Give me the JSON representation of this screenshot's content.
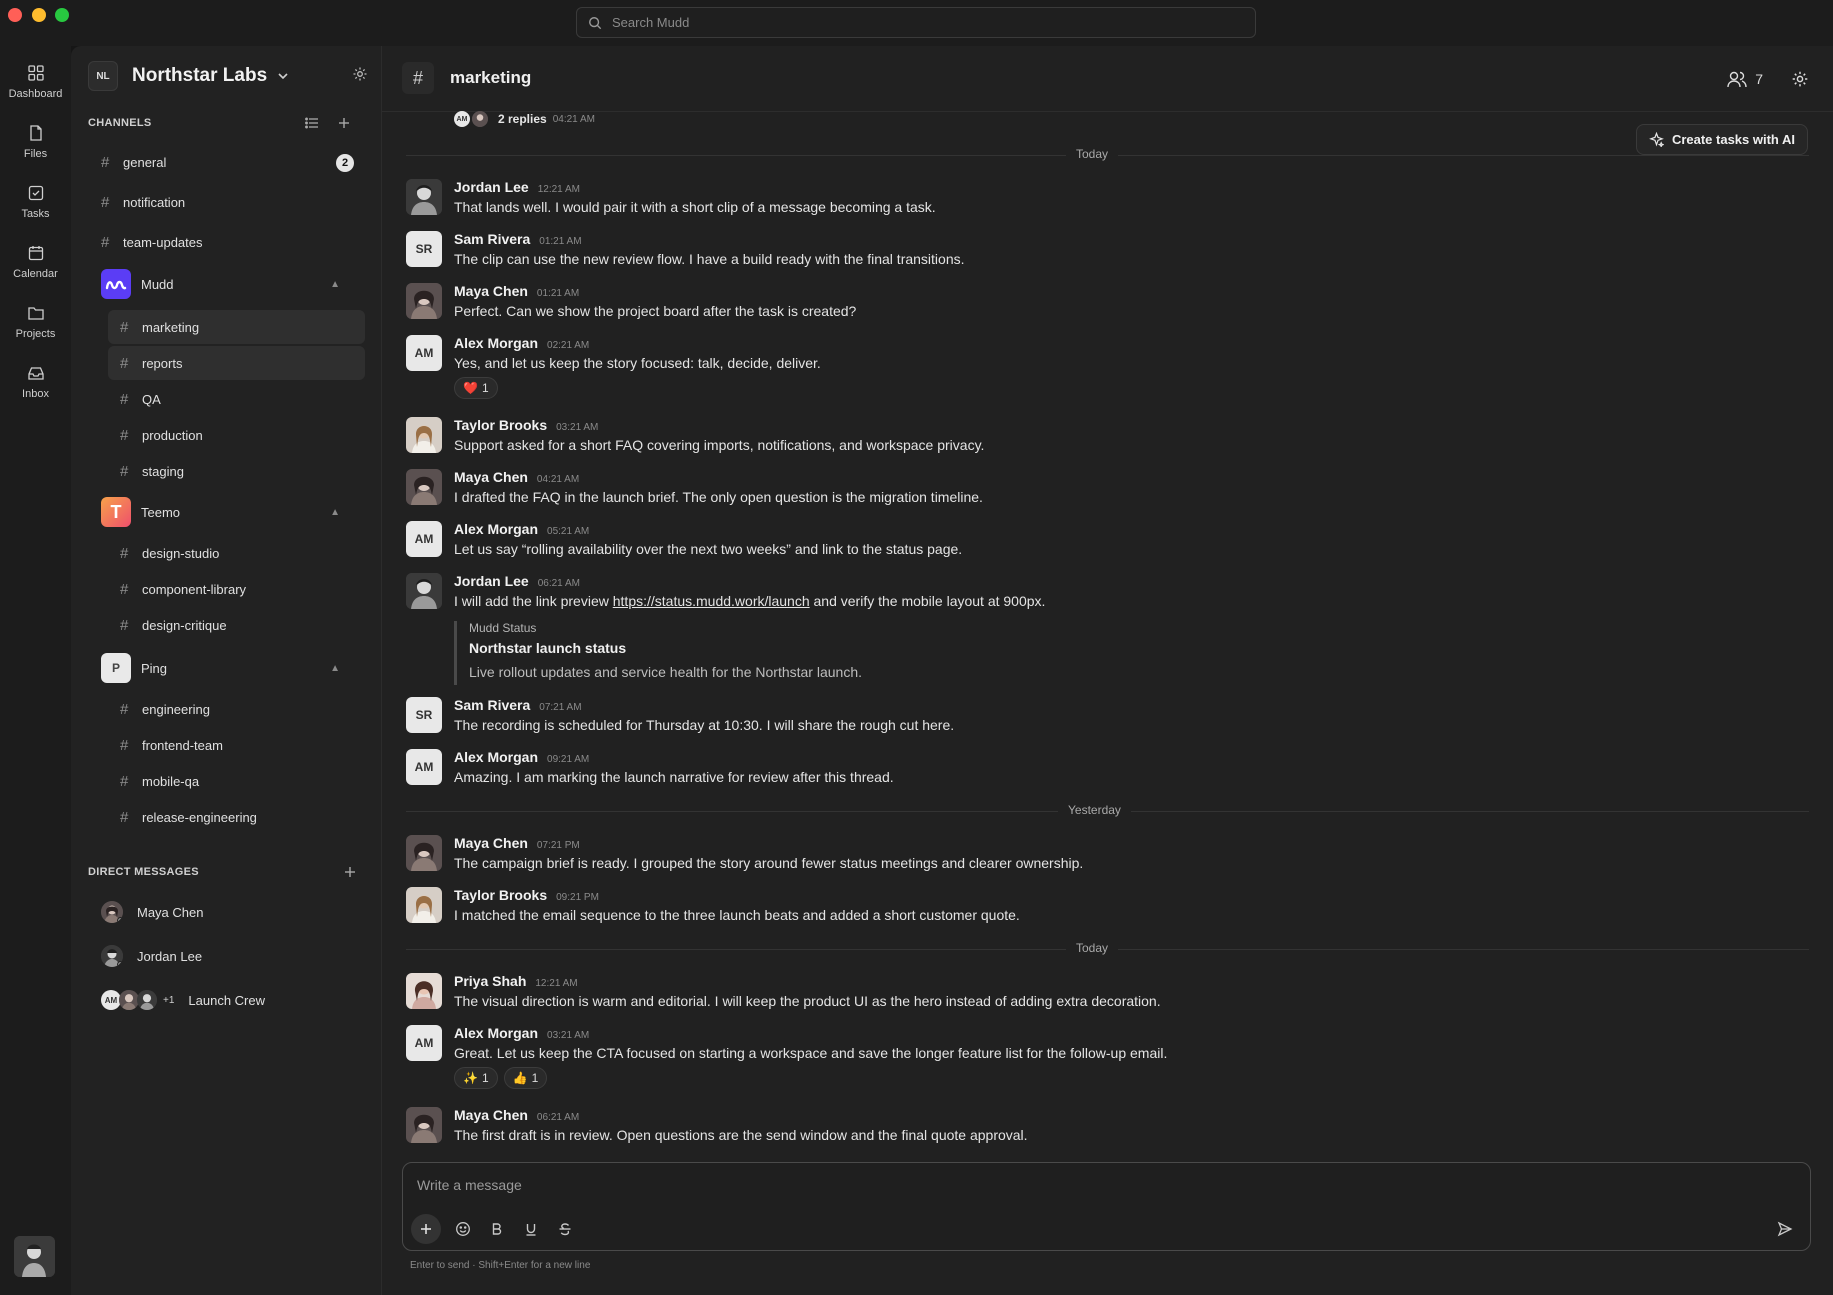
{
  "search": {
    "placeholder": "Search Mudd"
  },
  "rail": [
    {
      "label": "Dashboard",
      "icon": "dashboard-icon"
    },
    {
      "label": "Files",
      "icon": "file-icon"
    },
    {
      "label": "Tasks",
      "icon": "task-icon"
    },
    {
      "label": "Calendar",
      "icon": "calendar-icon"
    },
    {
      "label": "Projects",
      "icon": "folder-icon"
    },
    {
      "label": "Inbox",
      "icon": "inbox-icon"
    }
  ],
  "workspace": {
    "initials": "NL",
    "name": "Northstar Labs"
  },
  "channels_label": "CHANNELS",
  "channels": [
    {
      "name": "general",
      "badge": "2"
    },
    {
      "name": "notification"
    },
    {
      "name": "team-updates"
    }
  ],
  "groups": [
    {
      "name": "Mudd",
      "logo": "",
      "channels": [
        "marketing",
        "reports",
        "QA",
        "production",
        "staging"
      ]
    },
    {
      "name": "Teemo",
      "logo": "T",
      "channels": [
        "design-studio",
        "component-library",
        "design-critique"
      ]
    },
    {
      "name": "Ping",
      "logo": "P",
      "channels": [
        "engineering",
        "frontend-team",
        "mobile-qa",
        "release-engineering"
      ]
    }
  ],
  "dm_label": "DIRECT MESSAGES",
  "dms": [
    {
      "name": "Maya Chen"
    },
    {
      "name": "Jordan Lee"
    },
    {
      "name": "Launch Crew",
      "initials": "AM",
      "extra": "+1"
    }
  ],
  "header": {
    "channel": "marketing",
    "members": "7"
  },
  "ai_button": "Create tasks with AI",
  "thread_summary": {
    "initials": "AM",
    "replies": "2 replies",
    "time": "04:21 AM"
  },
  "dividers": [
    "Today",
    "Yesterday",
    "Today"
  ],
  "messages": [
    {
      "name": "Jordan Lee",
      "time": "12:21 AM",
      "text": "That lands well. I would pair it with a short clip of a message becoming a task."
    },
    {
      "name": "Sam Rivera",
      "initials": "SR",
      "time": "01:21 AM",
      "text": "The clip can use the new review flow. I have a build ready with the final transitions."
    },
    {
      "name": "Maya Chen",
      "time": "01:21 AM",
      "text": "Perfect. Can we show the project board after the task is created?"
    },
    {
      "name": "Alex Morgan",
      "initials": "AM",
      "time": "02:21 AM",
      "text": "Yes, and let us keep the story focused: talk, decide, deliver.",
      "reactions": [
        {
          "emoji": "❤️",
          "count": "1"
        }
      ]
    },
    {
      "name": "Taylor Brooks",
      "time": "03:21 AM",
      "text": "Support asked for a short FAQ covering imports, notifications, and workspace privacy."
    },
    {
      "name": "Maya Chen",
      "time": "04:21 AM",
      "text": "I drafted the FAQ in the launch brief. The only open question is the migration timeline."
    },
    {
      "name": "Alex Morgan",
      "initials": "AM",
      "time": "05:21 AM",
      "text": "Let us say “rolling availability over the next two weeks” and link to the status page."
    },
    {
      "name": "Jordan Lee",
      "time": "06:21 AM",
      "text_before": "I will add the link preview ",
      "link": "https://status.mudd.work/launch",
      "text_after": " and verify the mobile layout at 900px.",
      "preview": {
        "source": "Mudd Status",
        "title": "Northstar launch status",
        "desc": "Live rollout updates and service health for the Northstar launch."
      }
    },
    {
      "name": "Sam Rivera",
      "initials": "SR",
      "time": "07:21 AM",
      "text": "The recording is scheduled for Thursday at 10:30. I will share the rough cut here."
    },
    {
      "name": "Alex Morgan",
      "initials": "AM",
      "time": "09:21 AM",
      "text": "Amazing. I am marking the launch narrative for review after this thread."
    },
    {
      "name": "Maya Chen",
      "time": "07:21 PM",
      "text": "The campaign brief is ready. I grouped the story around fewer status meetings and clearer ownership."
    },
    {
      "name": "Taylor Brooks",
      "time": "09:21 PM",
      "text": "I matched the email sequence to the three launch beats and added a short customer quote."
    },
    {
      "name": "Priya Shah",
      "time": "12:21 AM",
      "text": "The visual direction is warm and editorial. I will keep the product UI as the hero instead of adding extra decoration."
    },
    {
      "name": "Alex Morgan",
      "initials": "AM",
      "time": "03:21 AM",
      "text": "Great. Let us keep the CTA focused on starting a workspace and save the longer feature list for the follow-up email.",
      "reactions": [
        {
          "emoji": "✨",
          "count": "1"
        },
        {
          "emoji": "👍",
          "count": "1"
        }
      ]
    },
    {
      "name": "Maya Chen",
      "time": "06:21 AM",
      "text": "The first draft is in review. Open questions are the send window and the final quote approval."
    }
  ],
  "composer": {
    "placeholder": "Write a message",
    "hint": "Enter to send · Shift+Enter for a new line"
  },
  "colors": {
    "mudd_logo": "#5b3df5",
    "teemo_logo": "#f06a4a",
    "accent": "#e6e6e6"
  }
}
